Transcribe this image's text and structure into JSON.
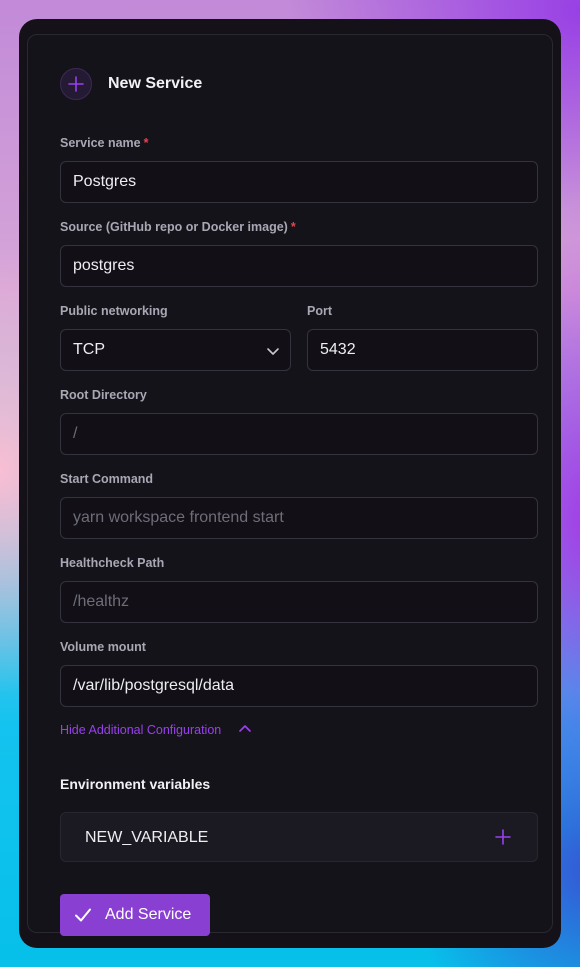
{
  "header": {
    "title": "New Service",
    "icon": "plus-circle-icon"
  },
  "form": {
    "service_name": {
      "label": "Service name",
      "required_mark": "*",
      "value": "Postgres"
    },
    "source": {
      "label": "Source (GitHub repo or Docker image)",
      "required_mark": "*",
      "value": "postgres"
    },
    "public_networking": {
      "label": "Public networking",
      "selected": "TCP"
    },
    "port": {
      "label": "Port",
      "value": "5432"
    },
    "root_directory": {
      "label": "Root Directory",
      "placeholder": "/"
    },
    "start_command": {
      "label": "Start Command",
      "placeholder": "yarn workspace frontend start"
    },
    "healthcheck_path": {
      "label": "Healthcheck Path",
      "placeholder": "/healthz"
    },
    "volume_mount": {
      "label": "Volume mount",
      "value": "/var/lib/postgresql/data"
    }
  },
  "toggle": {
    "label": "Hide Additional Configuration",
    "icon": "chevron-up-icon"
  },
  "env": {
    "title": "Environment variables",
    "new_variable": "NEW_VARIABLE"
  },
  "add_button": {
    "label": "Add Service",
    "icon": "check-icon"
  },
  "colors": {
    "accent": "#8a3fd3",
    "link": "#9a3ff0",
    "required": "#e0464e",
    "card_bg": "#141218"
  }
}
